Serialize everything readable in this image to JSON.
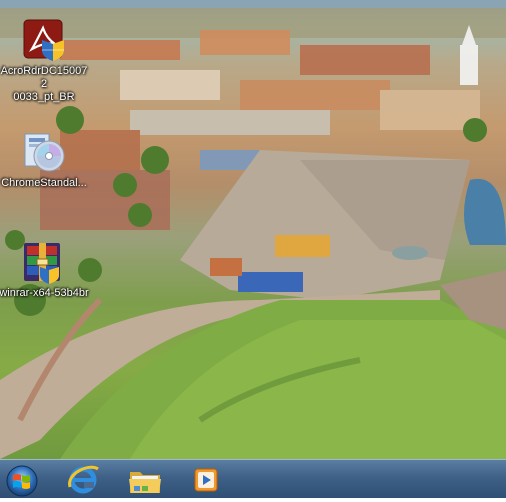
{
  "desktop": {
    "icons": [
      {
        "label": "AcroRdrDC150072\n0033_pt_BR",
        "icon": "acrobat-installer-icon"
      },
      {
        "label": "ChromeStandal...",
        "icon": "cd-installer-icon"
      },
      {
        "label": "winrar-x64-53b4br",
        "icon": "winrar-icon"
      }
    ]
  },
  "taskbar": {
    "start": "windows-start-icon",
    "pinned": [
      "internet-explorer-icon",
      "file-explorer-icon",
      "media-player-icon"
    ]
  }
}
